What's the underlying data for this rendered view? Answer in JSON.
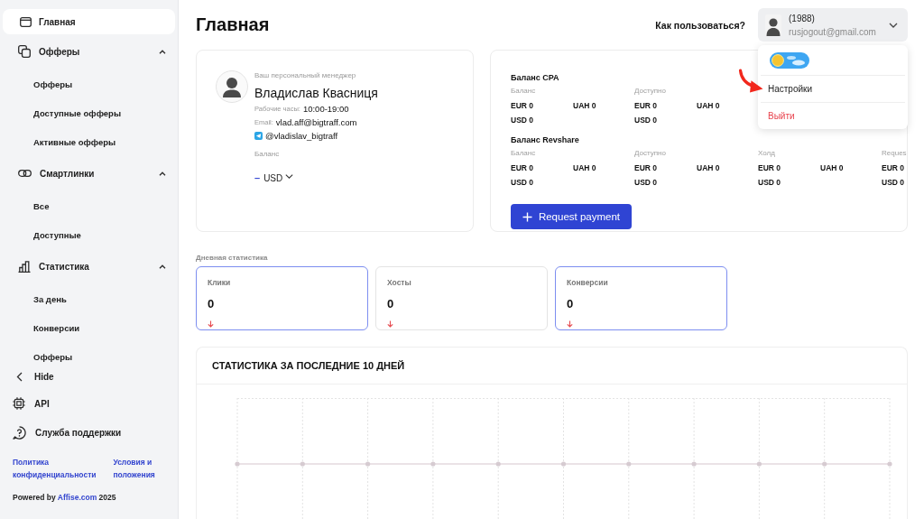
{
  "sidebar": {
    "items": [
      {
        "kind": "link",
        "label": "Главная",
        "selected": true
      },
      {
        "kind": "group",
        "label": "Офферы",
        "selected": false,
        "expanded": true,
        "children": [
          {
            "label": "Офферы",
            "selected": false
          },
          {
            "label": "Доступные офферы",
            "selected": false
          },
          {
            "label": "Активные офферы",
            "selected": false
          }
        ]
      },
      {
        "kind": "group",
        "label": "Смартлинки",
        "selected": false,
        "expanded": true,
        "children": [
          {
            "label": "Все",
            "selected": false
          },
          {
            "label": "Доступные",
            "selected": false
          }
        ]
      },
      {
        "kind": "group",
        "label": "Статистика",
        "selected": false,
        "expanded": true,
        "children": [
          {
            "label": "За день",
            "selected": false
          },
          {
            "label": "Конверсии",
            "selected": false
          },
          {
            "label": "Офферы",
            "selected": false
          }
        ]
      }
    ],
    "footer_items": [
      {
        "label": "Hide"
      },
      {
        "label": "API"
      },
      {
        "label": "Служба поддержки"
      }
    ],
    "links": [
      {
        "label": "Политика конфиденциальности"
      },
      {
        "label": "Условия и положения"
      }
    ],
    "powered_by": {
      "text": "Powered by",
      "link": "Affise.com",
      "year": "2025"
    }
  },
  "header": {
    "title": "Главная",
    "help_link": "Как пользоваться?",
    "user": {
      "name": "(1988)",
      "email": "rusjogout@gmail.com"
    }
  },
  "user_menu": {
    "dark_mode": false,
    "items": [
      {
        "kind": "normal",
        "label": "Настройки"
      },
      {
        "kind": "danger",
        "label": "Выйти"
      }
    ]
  },
  "manager": {
    "caption": "Ваш персональный менеджер",
    "name": "Владислав Квасниця",
    "hours_label": "Рабочие часы:",
    "hours": "10:00-19:00",
    "email_label": "Email:",
    "email": "vlad.aff@bigtraff.com",
    "telegram": "@vladislav_bigtraff",
    "balance_label": "Баланс",
    "balance_amount": "–",
    "balance_currency": "USD"
  },
  "balances": {
    "groups": [
      {
        "title": "Баланс CPA",
        "columns": [
          {
            "label": "Баланс",
            "rows": [
              [
                "EUR 0",
                "UAH 0"
              ],
              [
                "USD 0"
              ]
            ]
          },
          {
            "label": "Доступно",
            "rows": [
              [
                "EUR 0",
                "UAH 0"
              ],
              [
                "USD 0"
              ]
            ]
          }
        ]
      },
      {
        "title": "Баланс Revshare",
        "columns": [
          {
            "label": "Баланс",
            "rows": [
              [
                "EUR 0",
                "UAH 0"
              ],
              [
                "USD 0"
              ]
            ]
          },
          {
            "label": "Доступно",
            "rows": [
              [
                "EUR 0",
                "UAH 0"
              ],
              [
                "USD 0"
              ]
            ]
          },
          {
            "label": "Холд",
            "rows": [
              [
                "EUR 0",
                "UAH 0"
              ],
              [
                "USD 0"
              ]
            ]
          },
          {
            "label": "Reques",
            "rows": [
              [
                "EUR 0"
              ],
              [
                "USD 0"
              ]
            ]
          }
        ]
      }
    ],
    "button": "Request payment"
  },
  "daily_stats": {
    "title": "Дневная статистика",
    "cards": [
      {
        "label": "Клики",
        "value": "0",
        "selected": true
      },
      {
        "label": "Хосты",
        "value": "0",
        "selected": false
      },
      {
        "label": "Конверсии",
        "value": "0",
        "selected": true
      }
    ]
  },
  "history_chart": {
    "title": "СТАТИСТИКА ЗА ПОСЛЕДНИЕ 10 ДНЕЙ"
  }
}
